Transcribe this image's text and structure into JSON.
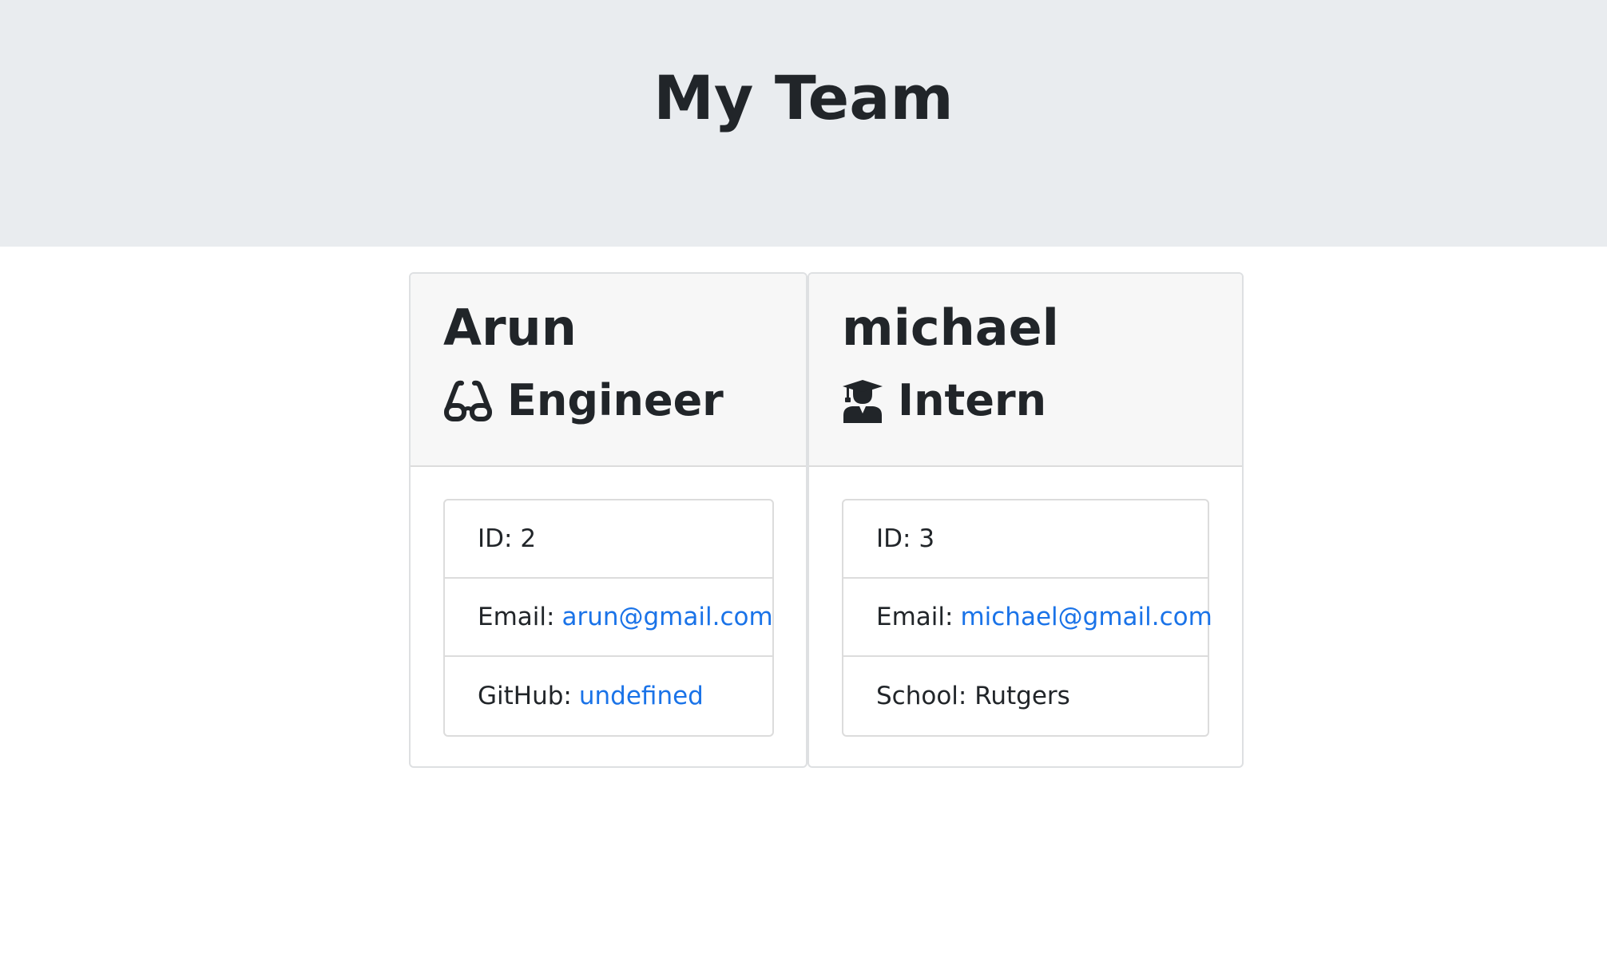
{
  "header": {
    "title": "My Team"
  },
  "cards": [
    {
      "name": "Arun",
      "role": "Engineer",
      "role_icon": "glasses-icon",
      "details": {
        "id_label": "ID:",
        "id_value": "2",
        "email_label": "Email:",
        "email_value": "arun@gmail.com",
        "extra_label": "GitHub:",
        "extra_value": "undefined"
      }
    },
    {
      "name": "michael",
      "role": "Intern",
      "role_icon": "graduate-icon",
      "details": {
        "id_label": "ID:",
        "id_value": "3",
        "email_label": "Email:",
        "email_value": "michael@gmail.com",
        "extra_label": "School:",
        "extra_value": "Rutgers"
      }
    }
  ],
  "colors": {
    "header_bg": "#e9ecef",
    "card_header_bg": "#f7f7f7",
    "link": "#1a73e8",
    "text": "#212529"
  }
}
